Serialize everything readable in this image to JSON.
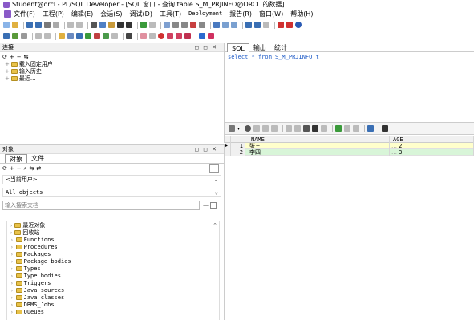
{
  "window": {
    "title": "Student@orcl - PL/SQL Developer - [SQL 窗口 - 查询 table S_M_PRJINFO@ORCL 的数据]"
  },
  "menu": [
    {
      "label": "文件(F)",
      "mono": false
    },
    {
      "label": "工程(P)",
      "mono": false
    },
    {
      "label": "编辑(E)",
      "mono": false
    },
    {
      "label": "会话(S)",
      "mono": false
    },
    {
      "label": "调试(D)",
      "mono": false
    },
    {
      "label": "工具(T)",
      "mono": false
    },
    {
      "label": "Deployment",
      "mono": true
    },
    {
      "label": "报告(R)",
      "mono": false
    },
    {
      "label": "窗口(W)",
      "mono": false
    },
    {
      "label": "帮助(H)",
      "mono": false
    }
  ],
  "connection_panel": {
    "title": "连接",
    "items": [
      "载入固定用户",
      "输入历史",
      "最近..."
    ]
  },
  "object_panel": {
    "title": "对象",
    "tabs": [
      "对象",
      "文件"
    ],
    "user_combo": "<当前用户>",
    "filter_combo": "All objects",
    "search_placeholder": "输入搜索文档",
    "items": [
      "最近对象",
      "回收站",
      "Functions",
      "Procedures",
      "Packages",
      "Package bodies",
      "Types",
      "Type bodies",
      "Triggers",
      "Java sources",
      "Java classes",
      "DBMS_Jobs",
      "Queues"
    ]
  },
  "sql_window": {
    "tabs": [
      "SQL",
      "输出",
      "统计"
    ],
    "query": "select * from S_M_PRJINFO t"
  },
  "result_grid": {
    "columns": [
      "NAME",
      "AGE"
    ],
    "rows": [
      {
        "num": "1",
        "name": "张三",
        "age": "2"
      },
      {
        "num": "2",
        "name": "李四",
        "age": "3"
      }
    ]
  },
  "colors": {
    "accent_yellow": "#ffffcc",
    "selected_green": "#d8f5d8",
    "keyword_blue": "#1a58c6"
  }
}
